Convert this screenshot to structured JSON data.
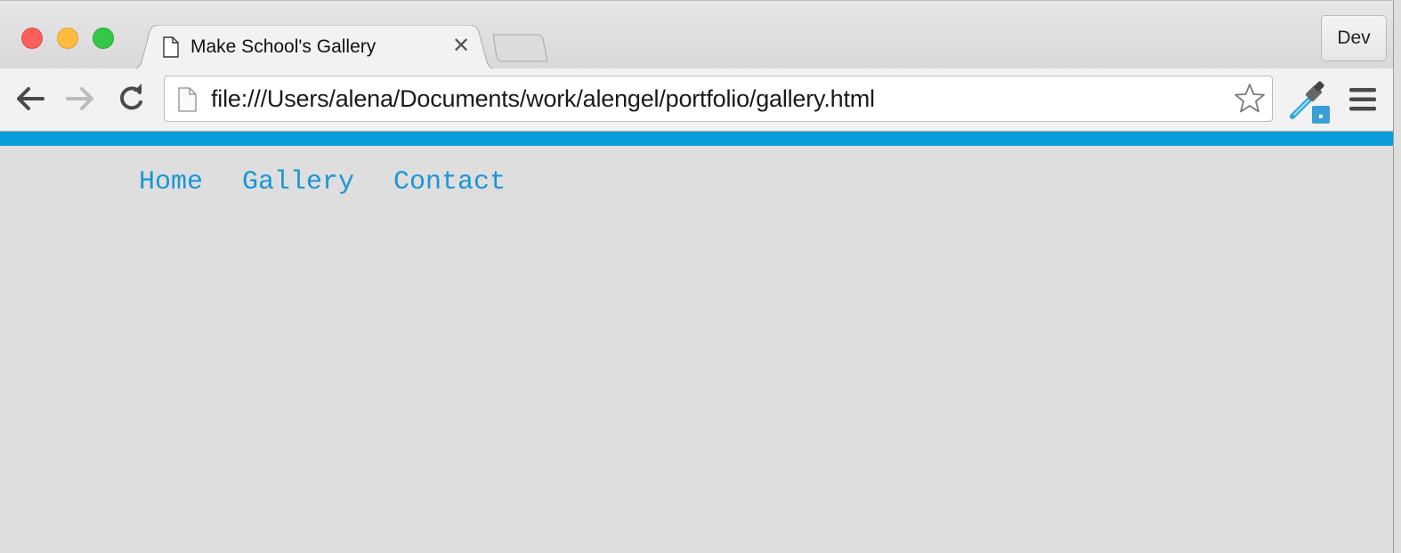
{
  "browser": {
    "tab": {
      "title": "Make School's Gallery",
      "close_glyph": "✕",
      "icon": "document-icon"
    },
    "profile_button": "Dev",
    "address_bar": {
      "url": "file:///Users/alena/Documents/work/alengel/portfolio/gallery.html",
      "icon": "page-icon"
    },
    "toolbar_icons": [
      "back-arrow-icon",
      "forward-arrow-icon",
      "reload-icon",
      "star-icon",
      "eyedropper-extension-icon",
      "hamburger-menu-icon"
    ],
    "colors": {
      "accent_bar": "#0a9dd9",
      "link": "#1a96d4",
      "page_background": "#dedede"
    }
  },
  "page": {
    "nav": [
      {
        "label": "Home"
      },
      {
        "label": "Gallery"
      },
      {
        "label": "Contact"
      }
    ]
  }
}
